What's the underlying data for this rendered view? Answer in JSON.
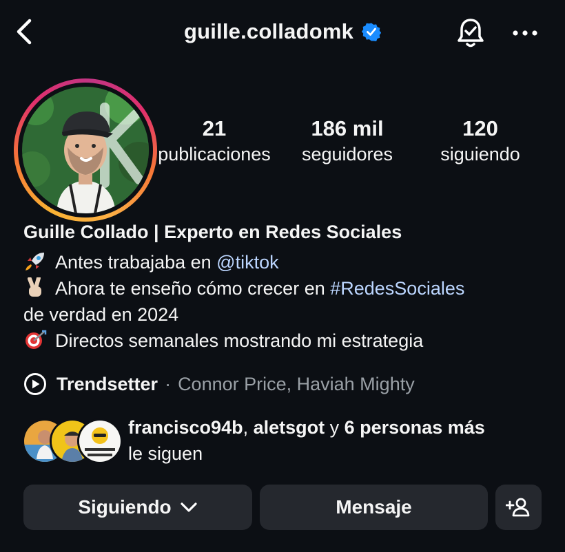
{
  "header": {
    "username": "guille.colladomk",
    "verified_color": "#1a8cff",
    "icons": {
      "back": "chevron-left-icon",
      "bell": "notification-bell-icon",
      "more": "more-horizontal-icon"
    }
  },
  "stats": {
    "posts": {
      "value": "21",
      "label": "publicaciones"
    },
    "followers": {
      "value": "186 mil",
      "label": "seguidores"
    },
    "following": {
      "value": "120",
      "label": "siguiendo"
    }
  },
  "bio": {
    "name": "Guille Collado | Experto en Redes Sociales",
    "line1_text": "Antes trabajaba en ",
    "line1_mention": "@tiktok",
    "line2_text": "Ahora te enseño cómo crecer en ",
    "line2_hashtag": "#RedesSociales",
    "line3_text": "de verdad en 2024",
    "line4_text": "Directos semanales mostrando mi estrategia",
    "emojis": [
      "rocket",
      "victory-hand",
      "direct-hit"
    ],
    "link_color": "#bcd6ff"
  },
  "music": {
    "title": "Trendsetter",
    "separator": "·",
    "artist": "Connor Price, Haviah Mighty"
  },
  "followed_by": {
    "user1": "francisco94b",
    "comma": ", ",
    "user2": "aletsgot",
    "connector": " y ",
    "others": "6 personas más",
    "suffix": "le siguen"
  },
  "actions": {
    "following_label": "Siguiendo",
    "message_label": "Mensaje"
  }
}
